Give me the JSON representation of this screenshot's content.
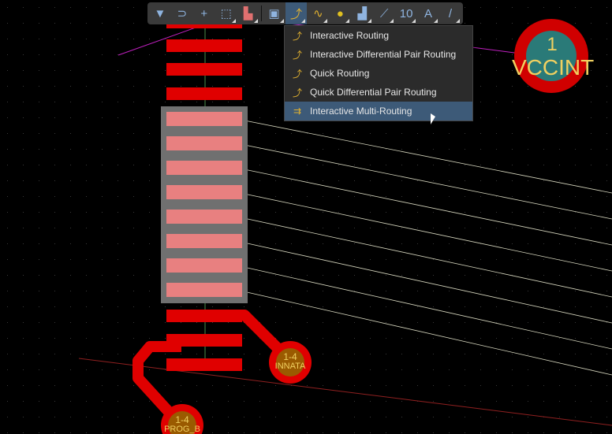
{
  "toolbar": {
    "buttons": [
      {
        "name": "filter",
        "glyph": "▼"
      },
      {
        "name": "snap-magnet",
        "glyph": "⊃"
      },
      {
        "name": "cross-select",
        "glyph": "+"
      },
      {
        "name": "select-rect",
        "glyph": "⬚"
      },
      {
        "name": "align",
        "glyph": "▙"
      },
      {
        "name": "component",
        "glyph": "▣"
      },
      {
        "name": "route",
        "glyph": "⤴"
      },
      {
        "name": "diff-pair-tune",
        "glyph": "∿"
      },
      {
        "name": "via",
        "glyph": "●"
      },
      {
        "name": "polygon",
        "glyph": "▟"
      },
      {
        "name": "keepout",
        "glyph": "⟋"
      },
      {
        "name": "dimension",
        "glyph": "10"
      },
      {
        "name": "text",
        "glyph": "A"
      },
      {
        "name": "line",
        "glyph": "/"
      }
    ]
  },
  "menu": {
    "items": [
      {
        "label": "Interactive Routing",
        "highlighted": false
      },
      {
        "label": "Interactive Differential Pair Routing",
        "highlighted": false
      },
      {
        "label": "Quick Routing",
        "highlighted": false
      },
      {
        "label": "Quick Differential Pair Routing",
        "highlighted": false
      },
      {
        "label": "Interactive Multi-Routing",
        "highlighted": true
      }
    ]
  },
  "pads": {
    "vccint": {
      "num": "1",
      "net": "VCCINT"
    },
    "via_a": {
      "num": "1-4",
      "net": "INNATA"
    },
    "via_b": {
      "num": "1-4",
      "net": "PROG_B"
    }
  },
  "colors": {
    "pad": "#e00000",
    "selected_pad": "#e88080",
    "highlight": "#3d5a78",
    "net_line": "#d8d8c0"
  }
}
